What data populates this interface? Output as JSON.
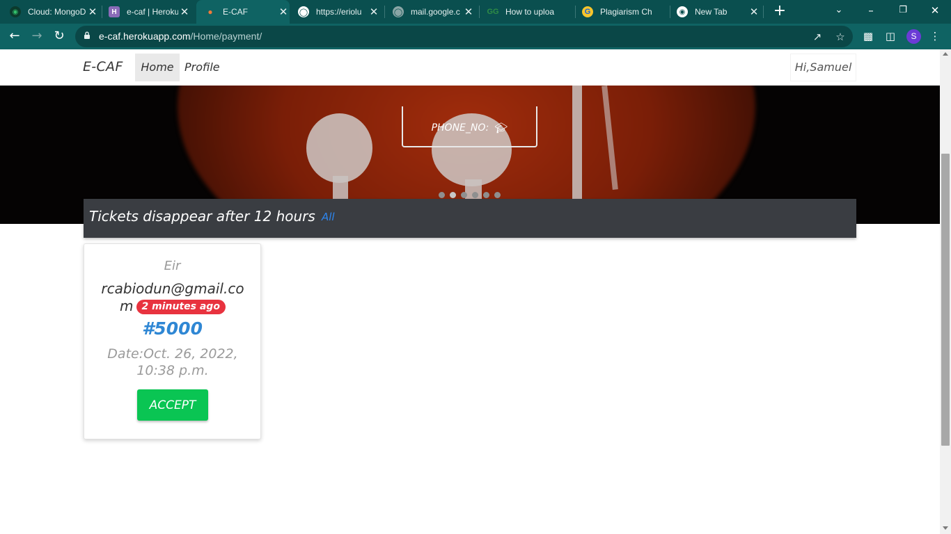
{
  "browser": {
    "tabs": [
      {
        "title": "Cloud: MongoDB",
        "icon": "mongodb-leaf-icon",
        "active": false
      },
      {
        "title": "e-caf | Heroku",
        "icon": "heroku-icon",
        "active": false
      },
      {
        "title": "E-CAF",
        "icon": "ecaf-favicon-icon",
        "active": true
      },
      {
        "title": "https://eriolu",
        "icon": "globe-icon",
        "active": false
      },
      {
        "title": "mail.google.c",
        "icon": "globe-icon",
        "active": false
      },
      {
        "title": "How to uploa",
        "icon": "geeksforgeeks-icon",
        "active": false
      },
      {
        "title": "Plagiarism Ch",
        "icon": "plagiarism-checker-icon",
        "active": false
      },
      {
        "title": "New Tab",
        "icon": "chrome-icon",
        "active": false
      }
    ],
    "address": {
      "host": "e-caf.herokuapp.com",
      "path": "/Home/payment/"
    },
    "profile_initial": "S"
  },
  "navbar": {
    "brand": "E-CAF",
    "home": "Home",
    "profile": "Profile",
    "greeting": "Hi,Samuel"
  },
  "hero": {
    "phone_label": "PHONE_NO:",
    "carousel_count": 6,
    "carousel_active": 1
  },
  "tickets": {
    "heading": "Tickets disappear after 12 hours",
    "all_link": "All",
    "items": [
      {
        "name": "Eir",
        "email": "rcabiodun@gmail.com",
        "age_badge": "2 minutes ago",
        "amount": "#5000",
        "date": "Date:Oct. 26, 2022, 10:38 p.m.",
        "accept_label": "ACCEPT"
      }
    ]
  },
  "colors": {
    "chrome_dark": "#0a4f4f",
    "chrome_toolbar": "#0f6363",
    "ticket_header_bg": "#3a3d42",
    "link_blue": "#2d86ef",
    "badge_red": "#e8333f",
    "amount_blue": "#2f87d4",
    "accept_green": "#0ac553"
  }
}
